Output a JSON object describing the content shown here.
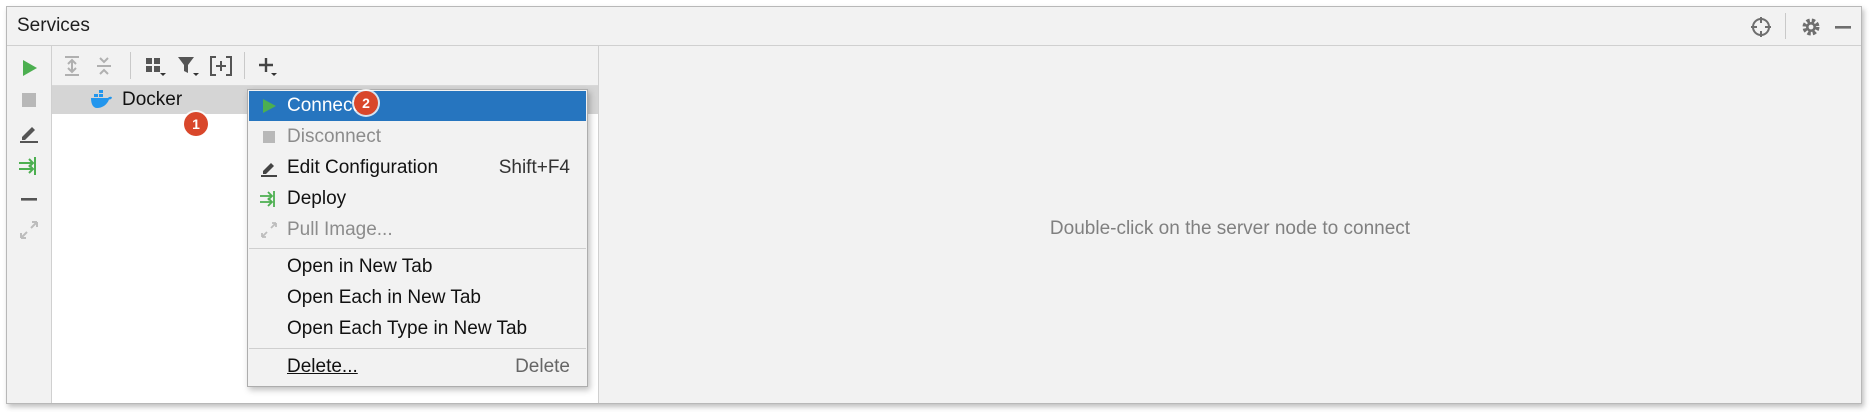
{
  "window": {
    "title": "Services"
  },
  "tree": {
    "items": [
      {
        "label": "Docker"
      }
    ]
  },
  "badges": {
    "first": "1",
    "second": "2"
  },
  "context_menu": {
    "items": [
      {
        "label": "Connect",
        "shortcut": ""
      },
      {
        "label": "Disconnect",
        "shortcut": ""
      },
      {
        "label": "Edit Configuration",
        "shortcut": "Shift+F4"
      },
      {
        "label": "Deploy",
        "shortcut": ""
      },
      {
        "label": "Pull Image...",
        "shortcut": ""
      },
      {
        "label": "Open in New Tab",
        "shortcut": ""
      },
      {
        "label": "Open Each in New Tab",
        "shortcut": ""
      },
      {
        "label": "Open Each Type in New Tab",
        "shortcut": ""
      },
      {
        "label": "Delete...",
        "shortcut": "Delete"
      }
    ]
  },
  "detail": {
    "hint": "Double-click on the server node to connect"
  },
  "colors": {
    "selection": "#2675bf",
    "run_green": "#4caf50",
    "badge_red": "#d9472b",
    "docker_blue": "#2396ed"
  }
}
